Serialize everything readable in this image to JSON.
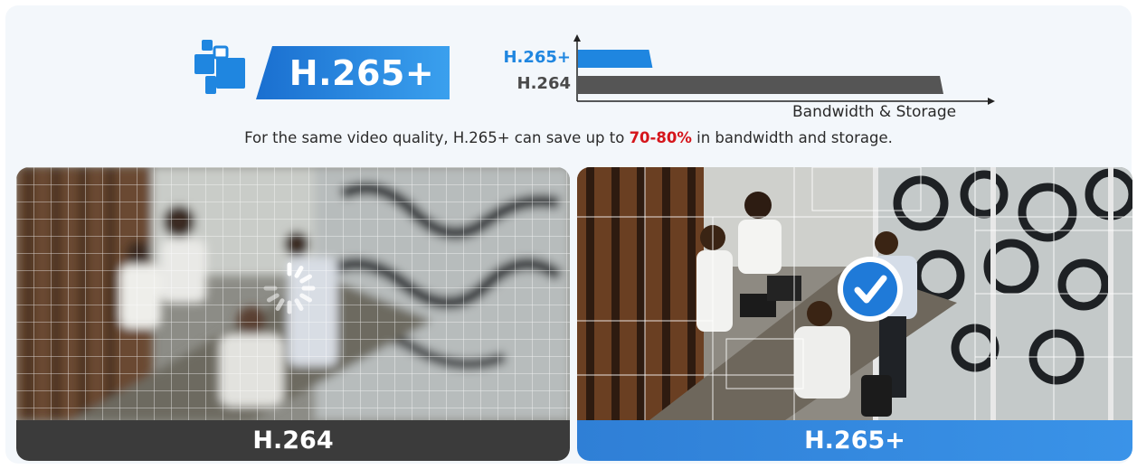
{
  "header": {
    "badge_label": "H.265+",
    "icon": "codec-blocks-icon"
  },
  "comparison_chart": {
    "bars": [
      {
        "label": "H.265+",
        "value": 0.2,
        "color": "#1f86e0"
      },
      {
        "label": "H.264",
        "value": 1.0,
        "color": "#555555"
      }
    ],
    "axis_label": "Bandwidth & Storage"
  },
  "caption": {
    "prefix": "For the same video quality, H.265+ can save up to ",
    "highlight": "70-80%",
    "suffix": " in bandwidth and storage."
  },
  "panels": {
    "left": {
      "label": "H.264",
      "icon": "loading-spinner-icon"
    },
    "right": {
      "label": "H.265+",
      "icon": "checkmark-icon"
    }
  },
  "colors": {
    "accent_blue": "#1f86e0",
    "bar_gray": "#555555",
    "highlight_red": "#d5151b",
    "footer_dark": "#3b3b3b"
  }
}
